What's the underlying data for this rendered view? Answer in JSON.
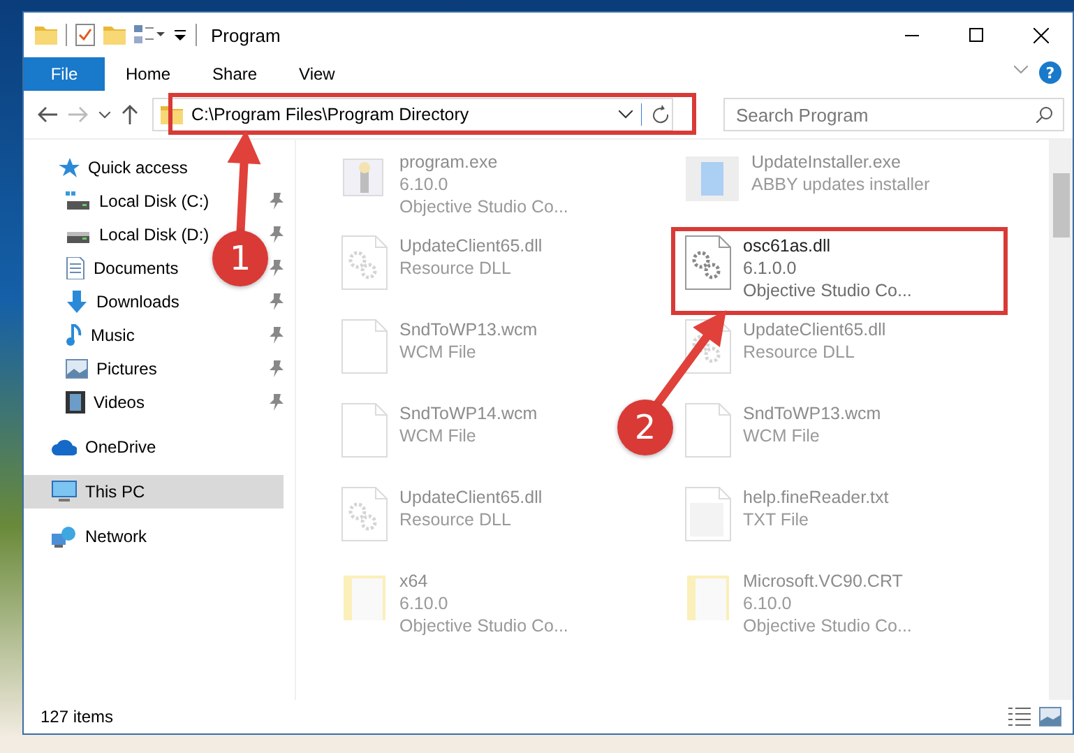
{
  "window": {
    "title": "Program"
  },
  "ribbon": {
    "tabs": [
      {
        "label": "File",
        "selected": true
      },
      {
        "label": "Home",
        "selected": false
      },
      {
        "label": "Share",
        "selected": false
      },
      {
        "label": "View",
        "selected": false
      }
    ],
    "help": "?"
  },
  "address": {
    "path": "C:\\Program Files\\Program Directory"
  },
  "search": {
    "placeholder": "Search Program"
  },
  "sidebar": {
    "items": [
      {
        "label": "Quick access",
        "kind": "star",
        "pinned": false,
        "selected": false,
        "children": [
          {
            "label": "Local Disk (C:)",
            "kind": "disk-c",
            "pinned": true,
            "selected": false
          },
          {
            "label": "Local Disk (D:)",
            "kind": "disk",
            "pinned": true,
            "selected": false
          },
          {
            "label": "Documents",
            "kind": "documents",
            "pinned": true,
            "selected": false
          },
          {
            "label": "Downloads",
            "kind": "downloads",
            "pinned": true,
            "selected": false
          },
          {
            "label": "Music",
            "kind": "music",
            "pinned": true,
            "selected": false
          },
          {
            "label": "Pictures",
            "kind": "pictures",
            "pinned": true,
            "selected": false
          },
          {
            "label": "Videos",
            "kind": "videos",
            "pinned": true,
            "selected": false
          }
        ]
      },
      {
        "label": "OneDrive",
        "kind": "cloud",
        "pinned": false,
        "selected": false
      },
      {
        "label": "This PC",
        "kind": "pc",
        "pinned": false,
        "selected": true
      },
      {
        "label": "Network",
        "kind": "network",
        "pinned": false,
        "selected": false
      }
    ]
  },
  "files": [
    {
      "name": "program.exe",
      "lines": [
        "6.10.0",
        "Objective Studio Co..."
      ],
      "kind": "exe",
      "faded": true
    },
    {
      "name": "UpdateInstaller.exe",
      "lines": [
        "ABBY updates installer"
      ],
      "kind": "installer",
      "faded": true
    },
    {
      "name": "UpdateClient65.dll",
      "lines": [
        "Resource DLL"
      ],
      "kind": "dll",
      "faded": true
    },
    {
      "name": "osc61as.dll",
      "lines": [
        "6.1.0.0",
        "Objective Studio Co..."
      ],
      "kind": "dll",
      "faded": false
    },
    {
      "name": "SndToWP13.wcm",
      "lines": [
        "WCM File"
      ],
      "kind": "doc",
      "faded": true
    },
    {
      "name": "UpdateClient65.dll",
      "lines": [
        "Resource DLL"
      ],
      "kind": "dll",
      "faded": true
    },
    {
      "name": "SndToWP14.wcm",
      "lines": [
        "WCM File"
      ],
      "kind": "doc",
      "faded": true
    },
    {
      "name": "SndToWP13.wcm",
      "lines": [
        "WCM File"
      ],
      "kind": "doc",
      "faded": true
    },
    {
      "name": "UpdateClient65.dll",
      "lines": [
        "Resource DLL"
      ],
      "kind": "dll",
      "faded": true
    },
    {
      "name": "help.fineReader.txt",
      "lines": [
        "TXT File"
      ],
      "kind": "txt",
      "faded": true
    },
    {
      "name": "x64",
      "lines": [
        "6.10.0",
        "Objective Studio Co..."
      ],
      "kind": "folder",
      "faded": true
    },
    {
      "name": "Microsoft.VC90.CRT",
      "lines": [
        "6.10.0",
        "Objective Studio Co..."
      ],
      "kind": "folder",
      "faded": true
    }
  ],
  "status_bar": {
    "count": "127 items"
  },
  "annotations": [
    {
      "number": "1",
      "kind": "address"
    },
    {
      "number": "2",
      "kind": "file"
    }
  ]
}
